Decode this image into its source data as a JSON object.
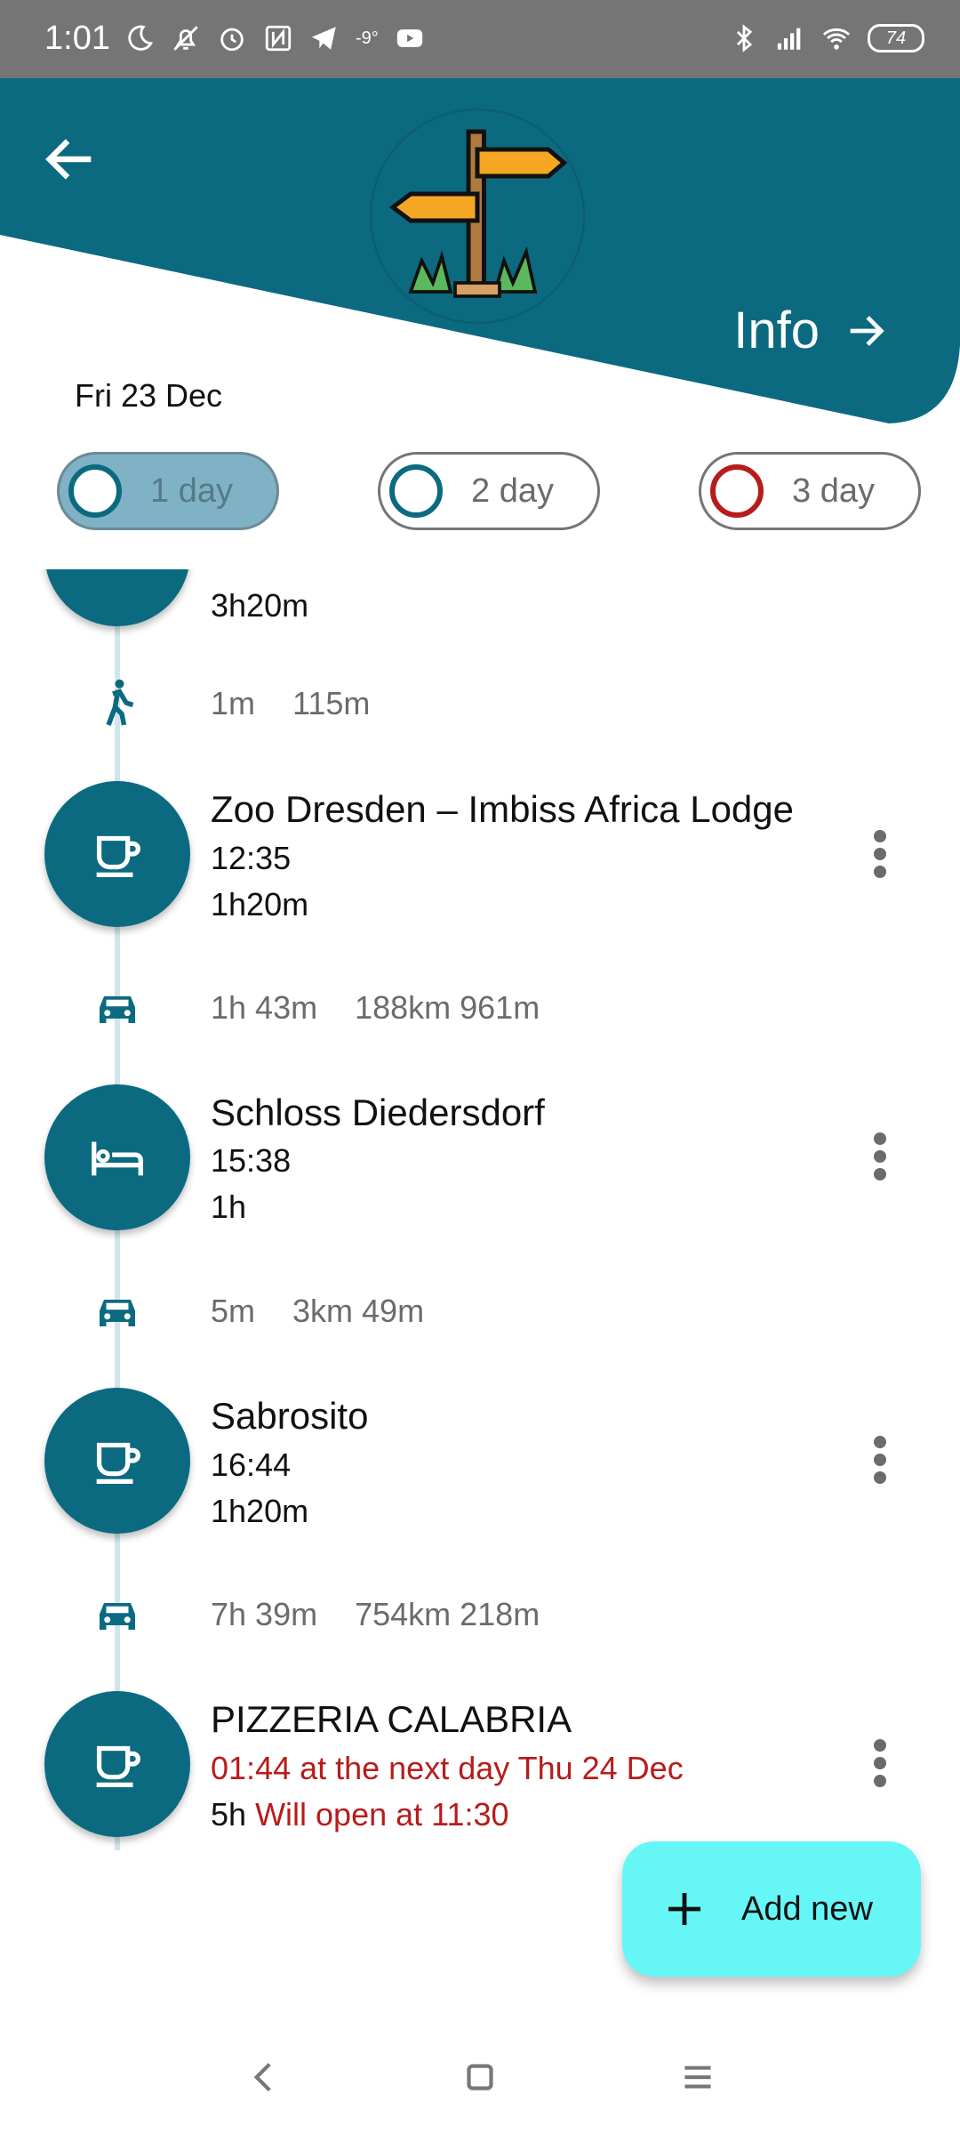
{
  "status_bar": {
    "time": "1:01",
    "temperature": "-9°",
    "battery": "74",
    "left_icons": [
      "moon-icon",
      "bell-off-icon",
      "alarm-icon",
      "nfc-icon",
      "telegram-icon",
      "temperature-icon",
      "youtube-icon"
    ],
    "right_icons": [
      "bluetooth-icon",
      "signal-icon",
      "wifi-icon",
      "battery-icon"
    ]
  },
  "header": {
    "back_icon": "arrow-left-icon",
    "logo_icon": "signpost-icon",
    "info_label": "Info",
    "info_icon": "arrow-right-icon",
    "color": "#0b6a80"
  },
  "date": "Fri 23 Dec",
  "day_tabs": [
    {
      "label": "1 day",
      "selected": true,
      "dot_color": "#0b6a80"
    },
    {
      "label": "2 day",
      "selected": false,
      "dot_color": "#0b6a80"
    },
    {
      "label": "3 day",
      "selected": false,
      "dot_color": "#b71c1c"
    }
  ],
  "timeline": {
    "partial_stop": {
      "duration": "3h20m"
    },
    "segments": [
      {
        "mode": "walk-icon",
        "time": "1m",
        "distance": "115m"
      },
      {
        "mode": "car-icon",
        "time": "1h 43m",
        "distance": "188km 961m"
      },
      {
        "mode": "car-icon",
        "time": "5m",
        "distance": "3km 49m"
      },
      {
        "mode": "car-icon",
        "time": "7h 39m",
        "distance": "754km 218m"
      }
    ],
    "stops": [
      {
        "name": "Zoo Dresden – Imbiss Africa Lodge",
        "arrival": "12:35",
        "duration": "1h20m",
        "icon": "coffee-icon"
      },
      {
        "name": "Schloss Diedersdorf",
        "arrival": "15:38",
        "duration": "1h",
        "icon": "bed-icon"
      },
      {
        "name": "Sabrosito",
        "arrival": "16:44",
        "duration": "1h20m",
        "icon": "coffee-icon"
      },
      {
        "name": "PIZZERIA CALABRIA",
        "arrival": "01:44 at the next day Thu 24 Dec",
        "duration": "5h",
        "warning": "Will open at 11:30",
        "icon": "coffee-icon"
      }
    ]
  },
  "fab": {
    "label": "Add new",
    "icon": "plus-icon",
    "color": "#66f6f6"
  },
  "nav": {
    "back_icon": "nav-back-icon",
    "home_icon": "nav-home-icon",
    "menu_icon": "nav-recents-icon"
  }
}
